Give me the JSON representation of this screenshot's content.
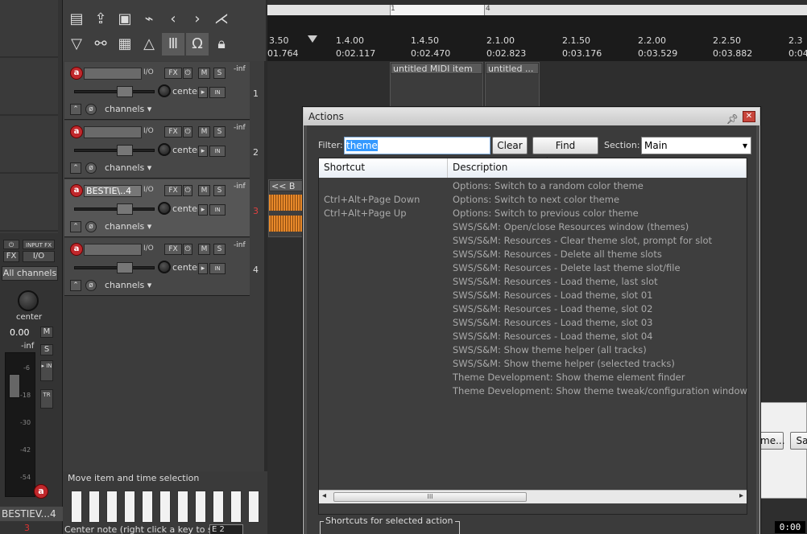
{
  "toolbar": {
    "row1": [
      "page-icon",
      "export-icon",
      "save-icon",
      "paperclip-icon",
      "chevron-left-icon",
      "chevron-right-icon",
      "metronome-icon"
    ],
    "row2": [
      "ripple-icon",
      "link-icon",
      "grid-icon",
      "envelope-icon",
      "columns-icon",
      "magnet-icon",
      "lock-icon"
    ]
  },
  "master": {
    "input_fx": "INPUT FX",
    "fx": "FX",
    "io": "I/O",
    "all_channels": "All channels",
    "pan_label": "center",
    "volume": "0.00",
    "inf": "-inf",
    "m": "M",
    "s": "S",
    "meter_ticks": [
      "-6",
      "-18",
      "-30",
      "-42",
      "-54"
    ],
    "name": "BESTIEV...4",
    "number": "3"
  },
  "tracks": [
    {
      "name": "",
      "io": "I/O",
      "fx": "FX",
      "m": "M",
      "s": "S",
      "pan": "center",
      "channels": "channels",
      "inf": "-inf",
      "number": "1"
    },
    {
      "name": "",
      "io": "I/O",
      "fx": "FX",
      "m": "M",
      "s": "S",
      "pan": "center",
      "channels": "channels",
      "inf": "-inf",
      "number": "2"
    },
    {
      "name": "BESTIE\\..4",
      "io": "I/O",
      "fx": "FX",
      "m": "M",
      "s": "S",
      "pan": "center",
      "channels": "channels",
      "inf": "-inf",
      "number": "3"
    },
    {
      "name": "",
      "io": "I/O",
      "fx": "FX",
      "m": "M",
      "s": "S",
      "pan": "center",
      "channels": "channels",
      "inf": "-inf",
      "number": "4"
    }
  ],
  "ruler": {
    "regions": [
      "1",
      "4"
    ],
    "measures": [
      "3.50",
      "1.4.00",
      "1.4.50",
      "2.1.00",
      "2.1.50",
      "2.2.00",
      "2.2.50",
      "2.3"
    ],
    "times": [
      "01.764",
      "0:02.117",
      "0:02.470",
      "0:02.823",
      "0:03.176",
      "0:03.529",
      "0:03.882",
      "0:04"
    ]
  },
  "items": {
    "midi1": "untitled MIDI item",
    "midi2": "untitled ...",
    "audio": "<< B"
  },
  "bottom": {
    "status": "Move item and time selection",
    "center_note": "Center note (right click a key to set):",
    "center_note_value": "E 2"
  },
  "dialog": {
    "title": "Actions",
    "filter_label": "Filter:",
    "filter_value": "theme",
    "clear": "Clear",
    "find_shortcut": "Find shortcut...",
    "section_label": "Section:",
    "section_value": "Main",
    "columns": [
      "Shortcut",
      "Description"
    ],
    "rows": [
      {
        "shortcut": "",
        "description": "Options: Switch to a random color theme"
      },
      {
        "shortcut": "Ctrl+Alt+Page Down",
        "description": "Options: Switch to next color theme"
      },
      {
        "shortcut": "Ctrl+Alt+Page Up",
        "description": "Options: Switch to previous color theme"
      },
      {
        "shortcut": "",
        "description": "SWS/S&M: Open/close Resources window (themes)"
      },
      {
        "shortcut": "",
        "description": "SWS/S&M: Resources - Clear theme slot, prompt for slot"
      },
      {
        "shortcut": "",
        "description": "SWS/S&M: Resources - Delete all theme slots"
      },
      {
        "shortcut": "",
        "description": "SWS/S&M: Resources - Delete last theme slot/file"
      },
      {
        "shortcut": "",
        "description": "SWS/S&M: Resources - Load theme, last slot"
      },
      {
        "shortcut": "",
        "description": "SWS/S&M: Resources - Load theme, slot 01"
      },
      {
        "shortcut": "",
        "description": "SWS/S&M: Resources - Load theme, slot 02"
      },
      {
        "shortcut": "",
        "description": "SWS/S&M: Resources - Load theme, slot 03"
      },
      {
        "shortcut": "",
        "description": "SWS/S&M: Resources - Load theme, slot 04"
      },
      {
        "shortcut": "",
        "description": "SWS/S&M: Show theme helper (all tracks)"
      },
      {
        "shortcut": "",
        "description": "SWS/S&M: Show theme helper (selected tracks)"
      },
      {
        "shortcut": "",
        "description": "Theme Development: Show theme element finder"
      },
      {
        "shortcut": "",
        "description": "Theme Development: Show theme tweak/configuration window"
      }
    ],
    "shortcuts_group": "Shortcuts for selected action",
    "scroll_grip": "III"
  },
  "behind_window": {
    "btn1": "me...",
    "btn2": "Sa"
  },
  "timer": "0:00",
  "colors": {
    "accent_red": "#c0282c",
    "selection_blue": "#3399ff",
    "waveform_orange": "#e8892a"
  }
}
